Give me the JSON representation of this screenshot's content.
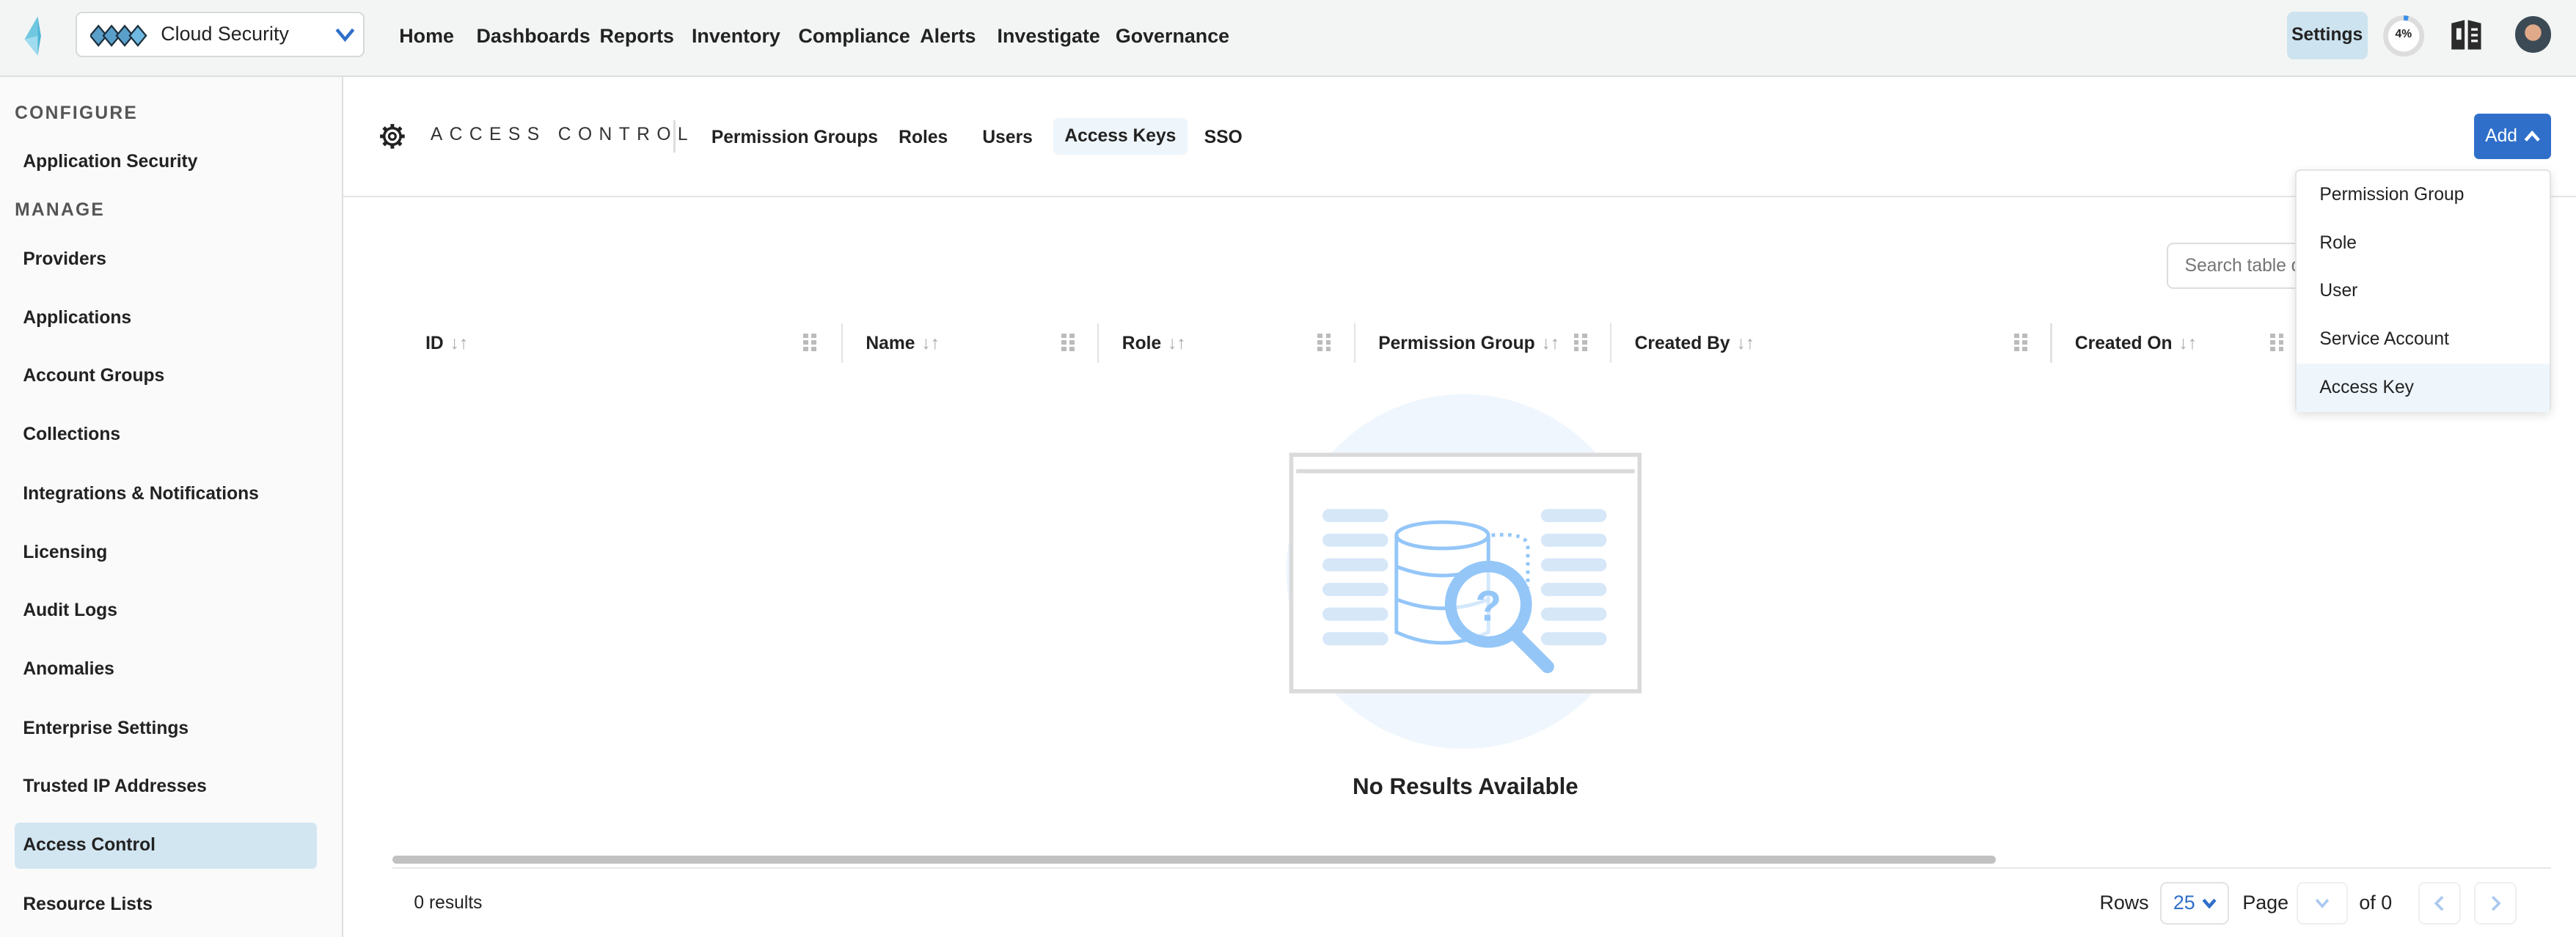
{
  "topbar": {
    "product": "Cloud Security",
    "nav": [
      "Home",
      "Dashboards",
      "Reports",
      "Inventory",
      "Compliance",
      "Alerts",
      "Investigate",
      "Governance"
    ],
    "settings_label": "Settings",
    "progress_label": "4%",
    "progress_value": 4
  },
  "sidebar": {
    "sections": [
      {
        "title": "CONFIGURE",
        "items": [
          "Application Security"
        ]
      },
      {
        "title": "MANAGE",
        "items": [
          "Providers",
          "Applications",
          "Account Groups",
          "Collections",
          "Integrations & Notifications",
          "Licensing",
          "Audit Logs",
          "Anomalies",
          "Enterprise Settings",
          "Trusted IP Addresses",
          "Access Control",
          "Resource Lists"
        ]
      }
    ],
    "selected": "Access Control"
  },
  "header": {
    "title": "ACCESS CONTROL",
    "tabs": [
      "Permission Groups",
      "Roles",
      "Users",
      "Access Keys",
      "SSO"
    ],
    "active_tab": "Access Keys",
    "add_label": "Add"
  },
  "add_menu": {
    "items": [
      "Permission Group",
      "Role",
      "User",
      "Service Account",
      "Access Key"
    ],
    "highlighted": "Access Key"
  },
  "table": {
    "search_placeholder": "Search table data",
    "columns": [
      "ID",
      "Name",
      "Role",
      "Permission Group",
      "Created By",
      "Created On"
    ],
    "empty_text": "No Results Available"
  },
  "footer": {
    "results": "0 results",
    "rows_label": "Rows",
    "rows_value": "25",
    "page_label": "Page",
    "of_label": "of 0"
  },
  "colors": {
    "accent": "#2f6fca",
    "selected": "#d2e6f1",
    "topbar": "#f3f5f4"
  }
}
